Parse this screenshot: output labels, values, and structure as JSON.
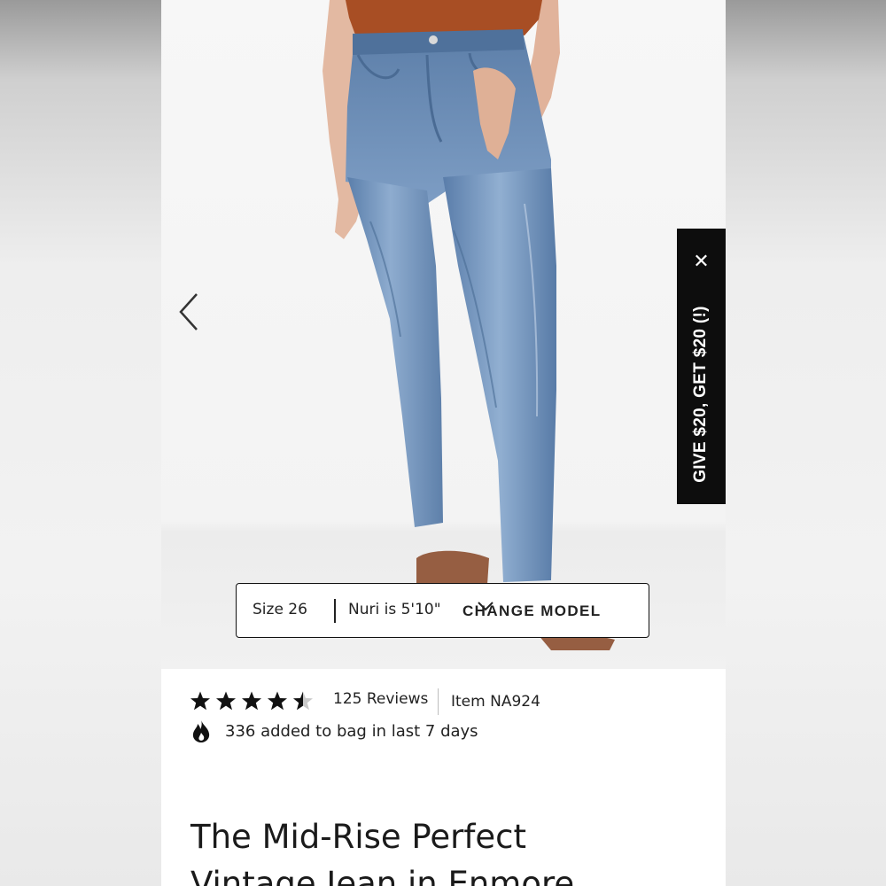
{
  "product": {
    "title_line1": "The Mid-Rise Perfect",
    "title_line2": "Vintage Jean in Enmore",
    "rating": 4.5,
    "rating_max": 5,
    "reviews_label": "125 Reviews",
    "item_label": "Item NA924",
    "popularity_text": "336 added to bag in last 7 days"
  },
  "model_bar": {
    "size_label": "Size 26",
    "model_height": "Nuri is 5'10\"",
    "change_label": "CHANGE MODEL"
  },
  "promo": {
    "label": "GIVE $20, GET $20 (!)",
    "close_symbol": "✕"
  },
  "colors": {
    "promo_bg": "#0d0d0d",
    "denim": "#6d8fb8",
    "top": "#a84e24",
    "text": "#1a1a1a"
  },
  "icons": {
    "prev": "chevron-left-icon",
    "dropdown": "chevron-down-icon",
    "popularity": "flame-icon",
    "rating": "star-icon"
  }
}
